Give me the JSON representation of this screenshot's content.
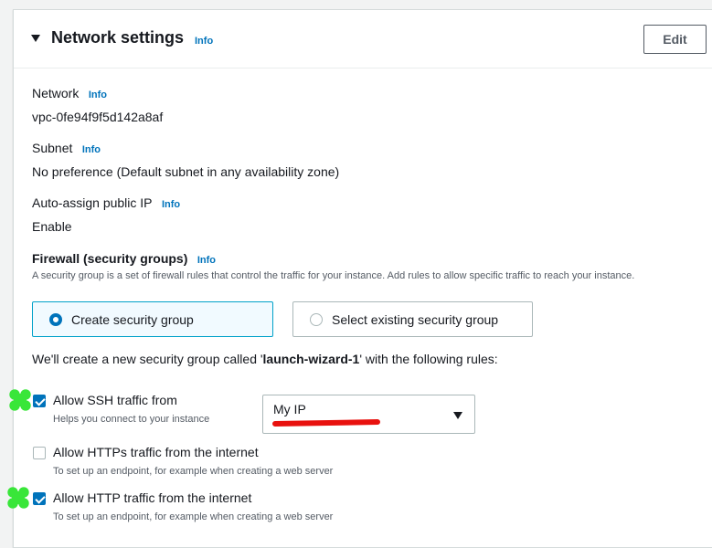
{
  "section": {
    "title": "Network settings",
    "info": "Info",
    "edit_label": "Edit"
  },
  "network": {
    "label": "Network",
    "info": "Info",
    "value": "vpc-0fe94f9f5d142a8af"
  },
  "subnet": {
    "label": "Subnet",
    "info": "Info",
    "value": "No preference (Default subnet in any availability zone)"
  },
  "public_ip": {
    "label": "Auto-assign public IP",
    "info": "Info",
    "value": "Enable"
  },
  "firewall": {
    "label": "Firewall (security groups)",
    "info": "Info",
    "description": "A security group is a set of firewall rules that control the traffic for your instance. Add rules to allow specific traffic to reach your instance.",
    "options": [
      {
        "label": "Create security group",
        "selected": true
      },
      {
        "label": "Select existing security group",
        "selected": false
      }
    ],
    "rules_intro_prefix": "We'll create a new security group called '",
    "group_name": "launch-wizard-1",
    "rules_intro_suffix": "' with the following rules:"
  },
  "rules": [
    {
      "label": "Allow SSH traffic from",
      "hint": "Helps you connect to your instance",
      "checked": true
    },
    {
      "label": "Allow HTTPs traffic from the internet",
      "hint": "To set up an endpoint, for example when creating a web server",
      "checked": false
    },
    {
      "label": "Allow HTTP traffic from the internet",
      "hint": "To set up an endpoint, for example when creating a web server",
      "checked": true
    }
  ],
  "ssh_source": {
    "selected": "My IP"
  },
  "colors": {
    "accent": "#0073bb",
    "selected_border": "#00a1c9",
    "annotation_red": "#e8110e",
    "annotation_green": "#39e639"
  }
}
